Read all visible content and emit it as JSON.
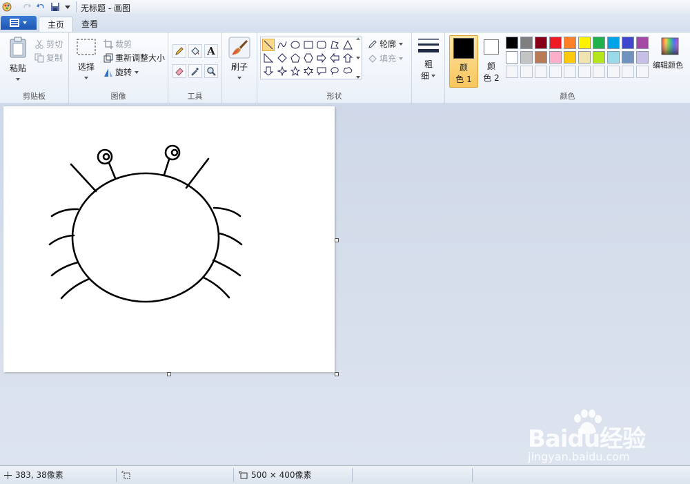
{
  "window": {
    "title": "无标题 - 画图"
  },
  "tabs": [
    "主页",
    "查看"
  ],
  "clipboard": {
    "paste": "粘贴",
    "cut": "剪切",
    "copy": "复制",
    "group_label": "剪贴板"
  },
  "image": {
    "select": "选择",
    "crop": "裁剪",
    "resize": "重新调整大小",
    "rotate": "旋转",
    "group_label": "图像"
  },
  "tools": {
    "group_label": "工具",
    "text_glyph": "A"
  },
  "brushes": {
    "label": "刷子"
  },
  "shapes": {
    "group_label": "形状",
    "outline": "轮廓",
    "fill": "填充"
  },
  "size": {
    "label_line1": "粗",
    "label_line2": "细"
  },
  "colors": {
    "color1_line1": "颜",
    "color1_line2": "色 1",
    "color2_line1": "颜",
    "color2_line2": "色 2",
    "edit_colors": "编辑颜色",
    "group_label": "颜色",
    "color1_value": "#000000",
    "color2_value": "#ffffff",
    "palette_row1": [
      "#000000",
      "#7f7f7f",
      "#880015",
      "#ed1c24",
      "#ff7f27",
      "#fff200",
      "#22b14c",
      "#00a2e8",
      "#3f48cc",
      "#a349a4"
    ],
    "palette_row2": [
      "#ffffff",
      "#c3c3c3",
      "#b97a57",
      "#ffaec9",
      "#ffc90e",
      "#efe4b0",
      "#b5e61d",
      "#99d9ea",
      "#7092be",
      "#c8bfe7"
    ]
  },
  "status": {
    "cursor_pos": "383, 38像素",
    "canvas_size": "500 × 400像素"
  },
  "watermark": {
    "brand": "Baidu经验",
    "site": "jingyan.baidu.com"
  }
}
